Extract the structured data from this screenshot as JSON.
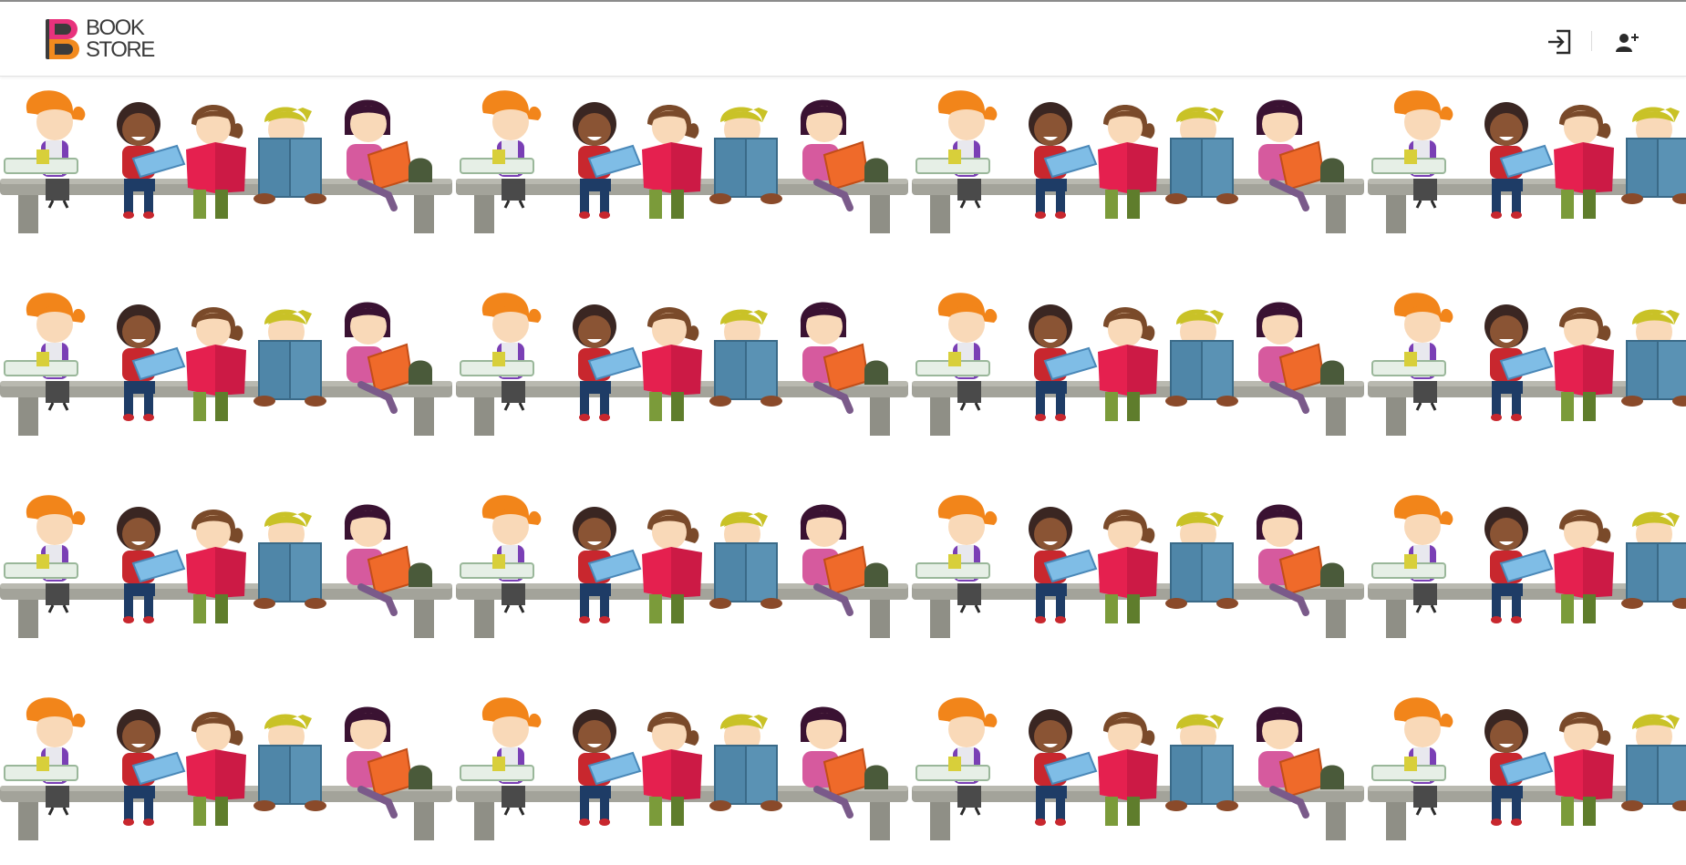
{
  "header": {
    "logo": {
      "line1": "BOOK",
      "line2": "STORE"
    },
    "login_icon": "login-icon",
    "signup_icon": "add-user-icon"
  },
  "colors": {
    "logo_pink": "#e8327c",
    "logo_orange": "#f28a1e",
    "logo_dark": "#3b3b3b",
    "bench": "#a3a39a",
    "book_pink": "#e5204f",
    "book_blue": "#4f86a8",
    "book_light_blue": "#7fbde6",
    "book_orange": "#ef6a2a"
  },
  "background": {
    "illustration": "kids-reading-on-bench-illustration",
    "kids": [
      {
        "hair": "#f2851a",
        "skin": "#f9d9b8",
        "shirt": "#7a3fb5",
        "pants": "#4a4a4a",
        "book": "#e6efe6"
      },
      {
        "hair": "#3a2622",
        "skin": "#8a5434",
        "shirt": "#c8272e",
        "pants": "#1e3c66",
        "book": "#7fbde6"
      },
      {
        "hair": "#7a4a2a",
        "skin": "#f9d9b8",
        "shirt": "#e5204f",
        "pants": "#7b9b3a",
        "book": "#e5204f"
      },
      {
        "hair": "#c9c227",
        "skin": "#f9d9b8",
        "shirt": "#4f86a8",
        "pants": "#8a4a2a",
        "book": "#4f86a8"
      },
      {
        "hair": "#3a1232",
        "skin": "#f9d9b8",
        "shirt": "#d65a9e",
        "pants": "#7a5a8a",
        "book": "#ef6a2a"
      }
    ]
  }
}
